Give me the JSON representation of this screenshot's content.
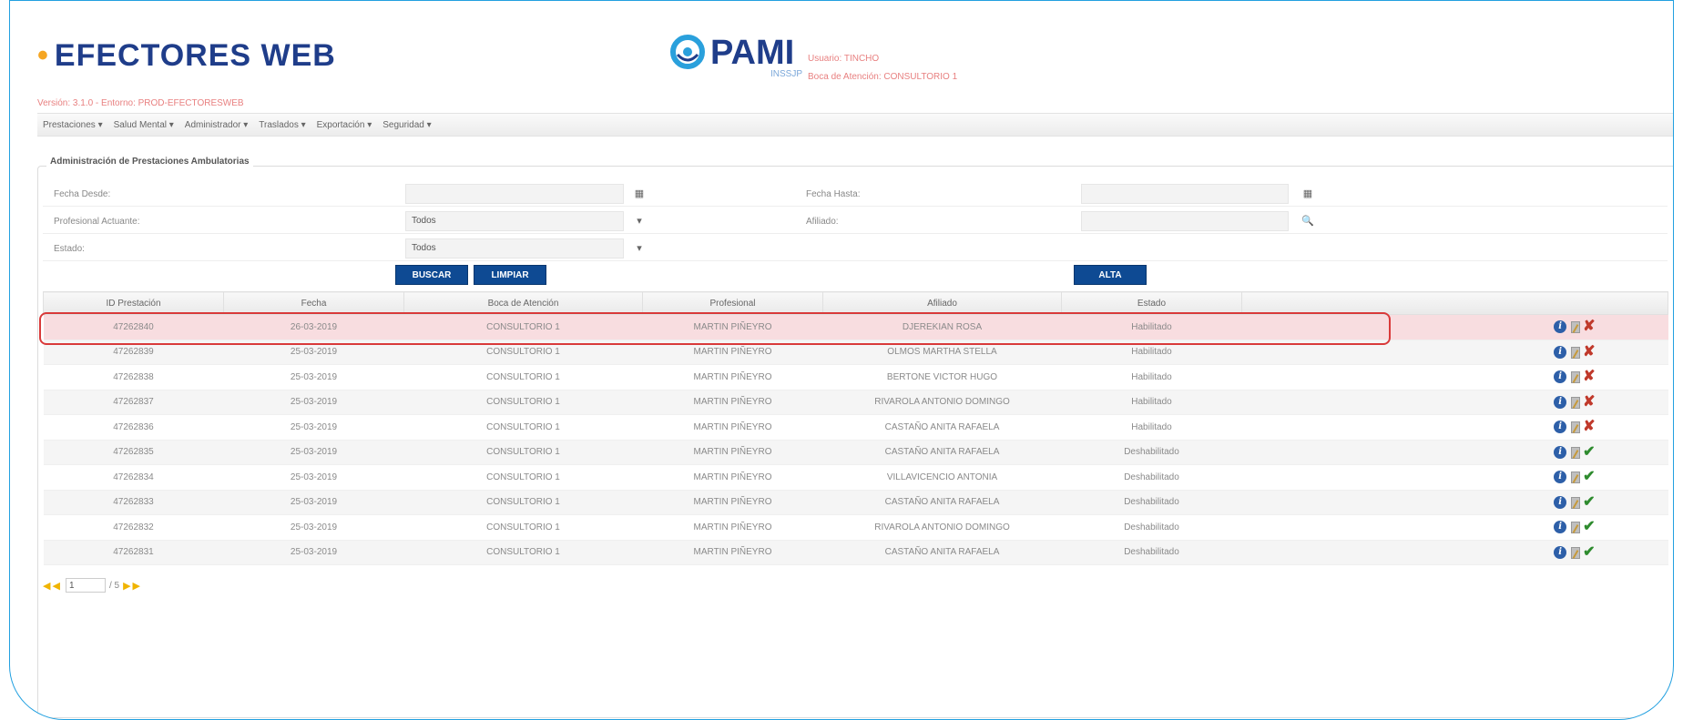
{
  "header": {
    "brand": "EFECTORES WEB",
    "pami_name": "PAMI",
    "pami_sub": "INSSJP",
    "user_line": "Usuario: TINCHO",
    "boca_line": "Boca de Atención: CONSULTORIO 1",
    "version": "Versión: 3.1.0 - Entorno: PROD-EFECTORESWEB"
  },
  "menu": [
    {
      "label": "Prestaciones ▾"
    },
    {
      "label": "Salud Mental ▾"
    },
    {
      "label": "Administrador ▾"
    },
    {
      "label": "Traslados ▾"
    },
    {
      "label": "Exportación ▾"
    },
    {
      "label": "Seguridad ▾"
    }
  ],
  "panel": {
    "legend": "Administración de Prestaciones Ambulatorias"
  },
  "form": {
    "fecha_desde_label": "Fecha Desde:",
    "fecha_desde_value": "",
    "fecha_hasta_label": "Fecha Hasta:",
    "fecha_hasta_value": "",
    "profesional_label": "Profesional Actuante:",
    "profesional_value": "Todos",
    "afiliado_label": "Afiliado:",
    "afiliado_value": "",
    "estado_label": "Estado:",
    "estado_value": "Todos",
    "calendar_glyph": "▦",
    "dropdown_glyph": "▾",
    "search_glyph": "🔍"
  },
  "buttons": {
    "buscar": "BUSCAR",
    "limpiar": "LIMPIAR",
    "alta": "ALTA"
  },
  "table": {
    "columns": [
      "ID Prestación",
      "Fecha",
      "Boca de Atención",
      "Profesional",
      "Afiliado",
      "Estado",
      ""
    ],
    "rows": [
      {
        "id": "47262840",
        "fecha": "26-03-2019",
        "boca": "CONSULTORIO 1",
        "profesional": "MARTIN PIÑEYRO",
        "afiliado": "DJEREKIAN ROSA",
        "estado": "Habilitado",
        "enabled": true
      },
      {
        "id": "47262839",
        "fecha": "25-03-2019",
        "boca": "CONSULTORIO 1",
        "profesional": "MARTIN PIÑEYRO",
        "afiliado": "OLMOS MARTHA STELLA",
        "estado": "Habilitado",
        "enabled": true
      },
      {
        "id": "47262838",
        "fecha": "25-03-2019",
        "boca": "CONSULTORIO 1",
        "profesional": "MARTIN PIÑEYRO",
        "afiliado": "BERTONE VICTOR HUGO",
        "estado": "Habilitado",
        "enabled": true
      },
      {
        "id": "47262837",
        "fecha": "25-03-2019",
        "boca": "CONSULTORIO 1",
        "profesional": "MARTIN PIÑEYRO",
        "afiliado": "RIVAROLA ANTONIO DOMINGO",
        "estado": "Habilitado",
        "enabled": true
      },
      {
        "id": "47262836",
        "fecha": "25-03-2019",
        "boca": "CONSULTORIO 1",
        "profesional": "MARTIN PIÑEYRO",
        "afiliado": "CASTAÑO ANITA RAFAELA",
        "estado": "Habilitado",
        "enabled": true
      },
      {
        "id": "47262835",
        "fecha": "25-03-2019",
        "boca": "CONSULTORIO 1",
        "profesional": "MARTIN PIÑEYRO",
        "afiliado": "CASTAÑO ANITA RAFAELA",
        "estado": "Deshabilitado",
        "enabled": false
      },
      {
        "id": "47262834",
        "fecha": "25-03-2019",
        "boca": "CONSULTORIO 1",
        "profesional": "MARTIN PIÑEYRO",
        "afiliado": "VILLAVICENCIO ANTONIA",
        "estado": "Deshabilitado",
        "enabled": false
      },
      {
        "id": "47262833",
        "fecha": "25-03-2019",
        "boca": "CONSULTORIO 1",
        "profesional": "MARTIN PIÑEYRO",
        "afiliado": "CASTAÑO ANITA RAFAELA",
        "estado": "Deshabilitado",
        "enabled": false
      },
      {
        "id": "47262832",
        "fecha": "25-03-2019",
        "boca": "CONSULTORIO 1",
        "profesional": "MARTIN PIÑEYRO",
        "afiliado": "RIVAROLA ANTONIO DOMINGO",
        "estado": "Deshabilitado",
        "enabled": false
      },
      {
        "id": "47262831",
        "fecha": "25-03-2019",
        "boca": "CONSULTORIO 1",
        "profesional": "MARTIN PIÑEYRO",
        "afiliado": "CASTAÑO ANITA RAFAELA",
        "estado": "Deshabilitado",
        "enabled": false
      }
    ],
    "selected_row": 0,
    "icons": {
      "info": "info-icon",
      "edit": "edit-icon",
      "delete": "x-icon",
      "enable": "check-icon"
    },
    "info_glyph": "i",
    "delete_glyph": "✘",
    "enable_glyph": "✔"
  },
  "pager": {
    "first_glyph": "◀",
    "prev_glyph": "◀",
    "next_glyph": "▶",
    "last_glyph": "▶",
    "current_page": "1",
    "total_text": "/ 5"
  },
  "colors": {
    "brand": "#1f3d8a",
    "accent": "#f5a623",
    "button": "#0e4a93",
    "selected_row": "#f8dde0",
    "highlight_outline": "#d93a3a",
    "frame": "#22a0e0"
  }
}
